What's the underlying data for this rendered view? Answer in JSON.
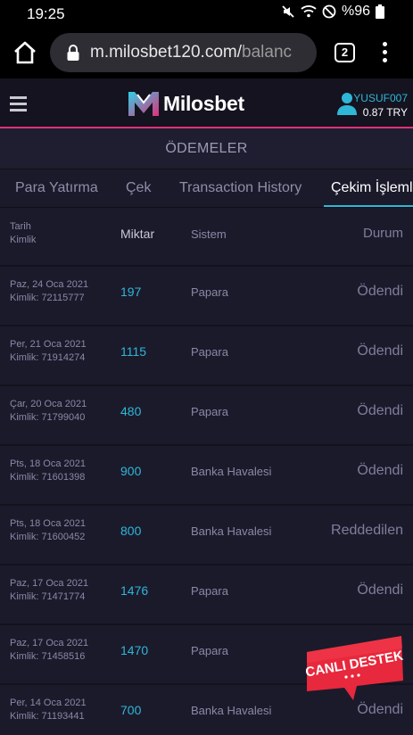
{
  "statusbar": {
    "time": "19:25",
    "battery": "%96"
  },
  "browser": {
    "url_main": "m.milosbet120.com/",
    "url_tail": "balanc",
    "tab_count": "2"
  },
  "site": {
    "logo_mark": "M",
    "logo_text": "Milosbet",
    "username": "YUSUF007",
    "balance": "0.87 TRY"
  },
  "page_title": "ÖDEMELER",
  "tabs": [
    {
      "label": "Para Yatırma"
    },
    {
      "label": "Çek"
    },
    {
      "label": "Transaction History"
    },
    {
      "label": "Çekim İşlemleri"
    }
  ],
  "table": {
    "headers": {
      "date": "Tarih",
      "id": "Kimlik",
      "amount": "Miktar",
      "system": "Sistem",
      "status": "Durum"
    },
    "rows": [
      {
        "date": "Paz, 24 Oca 2021",
        "id": "Kimlik: 72115777",
        "amount": "197",
        "system": "Papara",
        "status": "Ödendi"
      },
      {
        "date": "Per, 21 Oca 2021",
        "id": "Kimlik: 71914274",
        "amount": "1115",
        "system": "Papara",
        "status": "Ödendi"
      },
      {
        "date": "Çar, 20 Oca 2021",
        "id": "Kimlik: 71799040",
        "amount": "480",
        "system": "Papara",
        "status": "Ödendi"
      },
      {
        "date": "Pts, 18 Oca 2021",
        "id": "Kimlik: 71601398",
        "amount": "900",
        "system": "Banka Havalesi",
        "status": "Ödendi"
      },
      {
        "date": "Pts, 18 Oca 2021",
        "id": "Kimlik: 71600452",
        "amount": "800",
        "system": "Banka Havalesi",
        "status": "Reddedilen"
      },
      {
        "date": "Paz, 17 Oca 2021",
        "id": "Kimlik: 71471774",
        "amount": "1476",
        "system": "Papara",
        "status": "Ödendi"
      },
      {
        "date": "Paz, 17 Oca 2021",
        "id": "Kimlik: 71458516",
        "amount": "1470",
        "system": "Papara",
        "status": ""
      },
      {
        "date": "Per, 14 Oca 2021",
        "id": "Kimlik: 71193441",
        "amount": "700",
        "system": "Banka Havalesi",
        "status": "Ödendi"
      }
    ]
  },
  "support_badge": {
    "label": "CANLI DESTEK"
  },
  "colors": {
    "accent": "#2fb7d8",
    "brand_pink": "#e0307a",
    "background": "#1b1a2b",
    "badge_red": "#e8283c"
  }
}
